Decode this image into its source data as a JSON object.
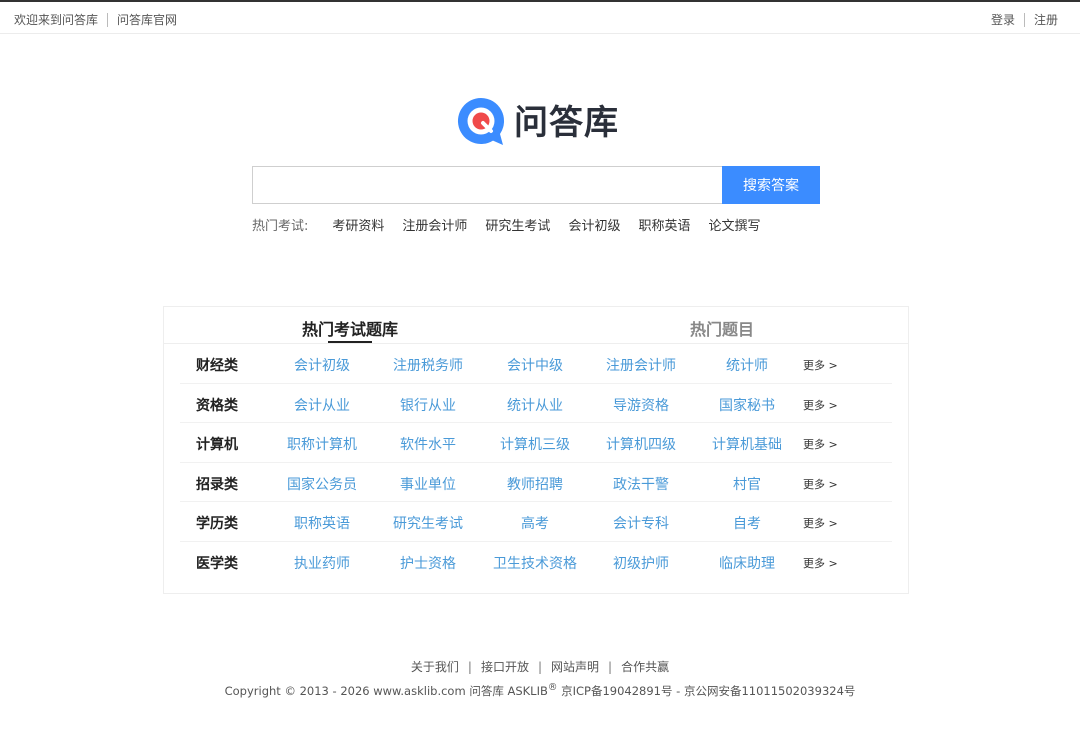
{
  "topbar": {
    "welcome": "欢迎来到问答库",
    "official_site": "问答库官网",
    "login": "登录",
    "register": "注册"
  },
  "logo": {
    "text": "问答库",
    "icon": "q-chat-bubble-icon",
    "colors": {
      "blue": "#3b8cff",
      "red": "#f04a4a"
    }
  },
  "search": {
    "value": "",
    "placeholder": "",
    "button_label": "搜索答案",
    "button_color": "#3b8cff"
  },
  "hot_exams": {
    "label": "热门考试:",
    "items": [
      "考研资料",
      "注册会计师",
      "研究生考试",
      "会计初级",
      "职称英语",
      "论文撰写"
    ]
  },
  "panel": {
    "tabs": [
      "热门考试题库",
      "热门题目"
    ],
    "active_tab": 0,
    "more_label": "更多 >",
    "link_color": "#4a9ad8",
    "rows": [
      {
        "category": "财经类",
        "items": [
          "会计初级",
          "注册税务师",
          "会计中级",
          "注册会计师",
          "统计师"
        ]
      },
      {
        "category": "资格类",
        "items": [
          "会计从业",
          "银行从业",
          "统计从业",
          "导游资格",
          "国家秘书"
        ]
      },
      {
        "category": "计算机",
        "items": [
          "职称计算机",
          "软件水平",
          "计算机三级",
          "计算机四级",
          "计算机基础"
        ]
      },
      {
        "category": "招录类",
        "items": [
          "国家公务员",
          "事业单位",
          "教师招聘",
          "政法干警",
          "村官"
        ]
      },
      {
        "category": "学历类",
        "items": [
          "职称英语",
          "研究生考试",
          "高考",
          "会计专科",
          "自考"
        ]
      },
      {
        "category": "医学类",
        "items": [
          "执业药师",
          "护士资格",
          "卫生技术资格",
          "初级护师",
          "临床助理"
        ]
      }
    ]
  },
  "footer": {
    "links": [
      "关于我们",
      "接口开放",
      "网站声明",
      "合作共赢"
    ],
    "separator": "|",
    "copyright_prefix": "Copyright © 2013 - 2026 www.asklib.com  问答库  ASKLIB",
    "registered_mark": "®",
    "copyright_suffix": " 京ICP备19042891号 - 京公网安备11011502039324号"
  }
}
